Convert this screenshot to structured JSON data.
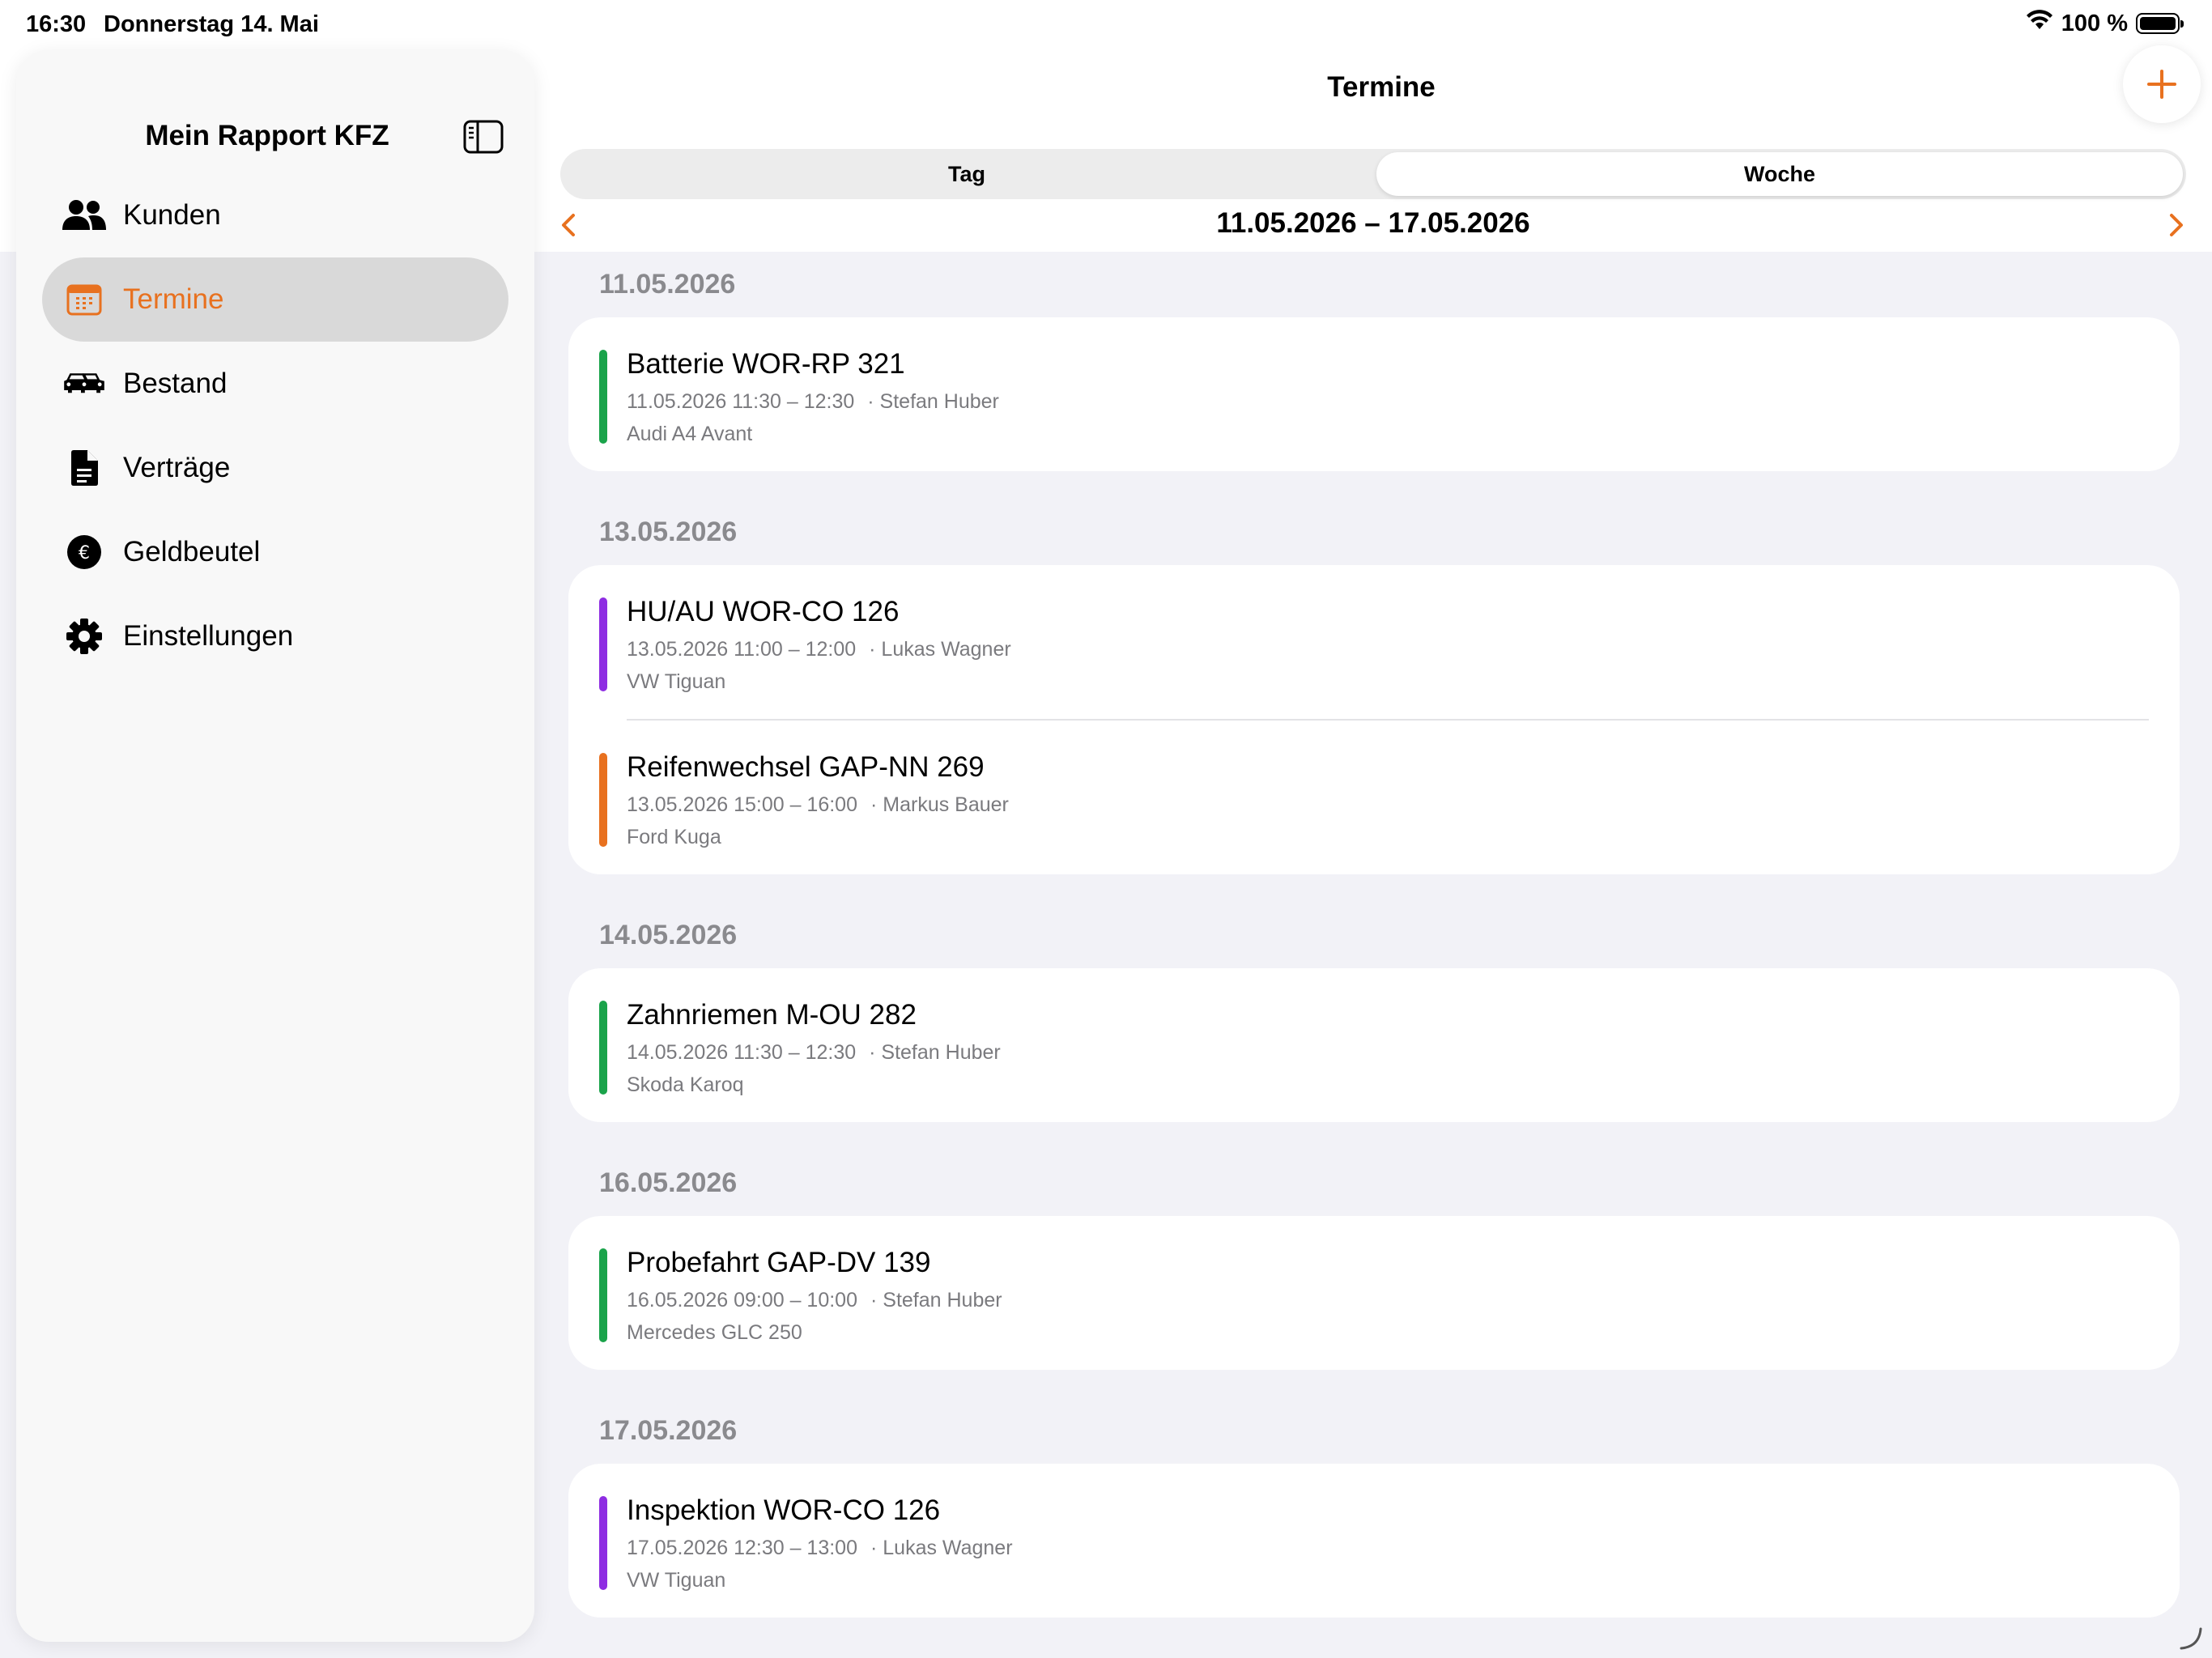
{
  "status_bar": {
    "time": "16:30",
    "date": "Donnerstag 14. Mai",
    "battery_percent": "100 %",
    "icons": [
      "wifi-icon",
      "battery-icon"
    ]
  },
  "sidebar": {
    "title": "Mein Rapport KFZ",
    "items": [
      {
        "label": "Kunden",
        "icon": "people-icon",
        "active": false
      },
      {
        "label": "Termine",
        "icon": "calendar-icon",
        "active": true
      },
      {
        "label": "Bestand",
        "icon": "cars-icon",
        "active": false
      },
      {
        "label": "Verträge",
        "icon": "document-icon",
        "active": false
      },
      {
        "label": "Geldbeutel",
        "icon": "euro-coin-icon",
        "active": false
      },
      {
        "label": "Einstellungen",
        "icon": "gear-icon",
        "active": false
      }
    ]
  },
  "main": {
    "title": "Termine",
    "segments": {
      "day": "Tag",
      "week": "Woche",
      "selected": "Woche"
    },
    "date_range": "11.05.2026 – 17.05.2026",
    "sections": [
      {
        "date": "11.05.2026",
        "appointments": [
          {
            "title": "Batterie WOR-RP 321",
            "time": "11.05.2026 11:30 – 12:30",
            "person": "· Stefan Huber",
            "vehicle": "Audi A4 Avant",
            "color": "#1aa34a"
          }
        ]
      },
      {
        "date": "13.05.2026",
        "appointments": [
          {
            "title": "HU/AU WOR-CO 126",
            "time": "13.05.2026 11:00 – 12:00",
            "person": "· Lukas Wagner",
            "vehicle": "VW Tiguan",
            "color": "#8e2de2"
          },
          {
            "title": "Reifenwechsel GAP-NN 269",
            "time": "13.05.2026 15:00 – 16:00",
            "person": "· Markus Bauer",
            "vehicle": "Ford Kuga",
            "color": "#e8711f"
          }
        ]
      },
      {
        "date": "14.05.2026",
        "appointments": [
          {
            "title": "Zahnriemen M-OU 282",
            "time": "14.05.2026 11:30 – 12:30",
            "person": "· Stefan Huber",
            "vehicle": "Skoda Karoq",
            "color": "#1aa34a"
          }
        ]
      },
      {
        "date": "16.05.2026",
        "appointments": [
          {
            "title": "Probefahrt GAP-DV 139",
            "time": "16.05.2026 09:00 – 10:00",
            "person": "· Stefan Huber",
            "vehicle": "Mercedes GLC 250",
            "color": "#1aa34a"
          }
        ]
      },
      {
        "date": "17.05.2026",
        "appointments": [
          {
            "title": "Inspektion WOR-CO 126",
            "time": "17.05.2026 12:30 – 13:00",
            "person": "· Lukas Wagner",
            "vehicle": "VW Tiguan",
            "color": "#8e2de2"
          }
        ]
      }
    ]
  },
  "colors": {
    "accent": "#e8711f",
    "green": "#1aa34a",
    "purple": "#8e2de2"
  }
}
